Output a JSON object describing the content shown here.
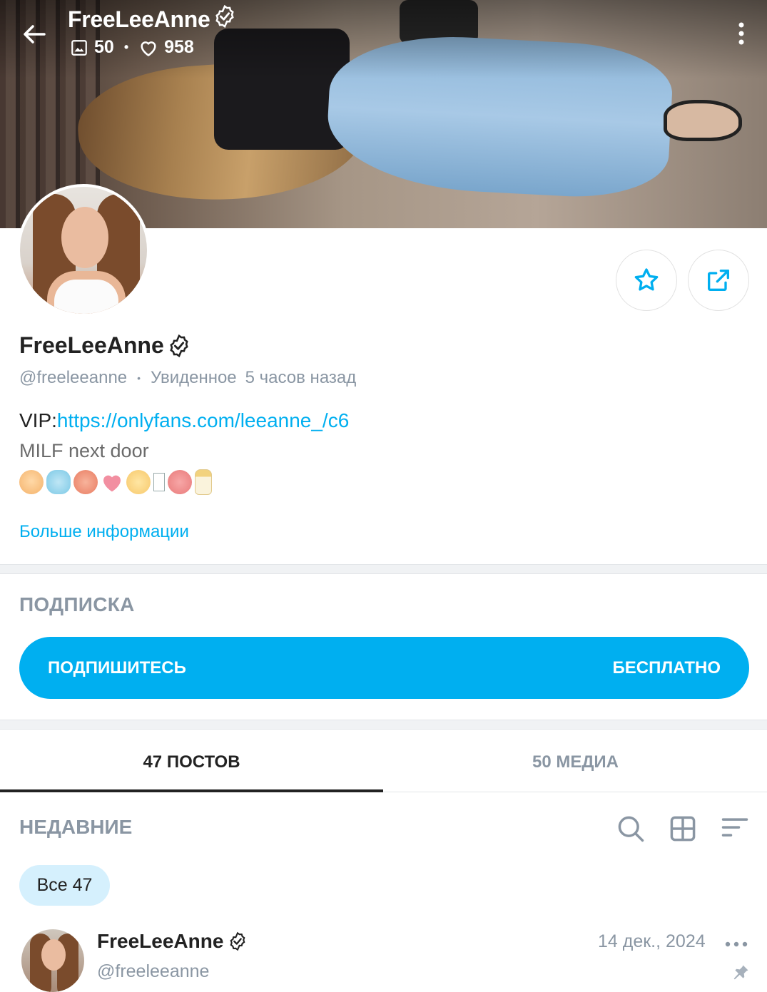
{
  "header": {
    "title": "FreeLeeAnne",
    "media_count": "50",
    "likes_count": "958"
  },
  "profile": {
    "name": "FreeLeeAnne",
    "handle": "@freeleeanne",
    "seen_label": "Увиденное",
    "seen_time": "5 часов назад",
    "bio_prefix": "VIP:",
    "bio_link": "https://onlyfans.com/leeanne_/c6",
    "bio_line": "MILF next door",
    "more_info": "Больше информации"
  },
  "subscription": {
    "title": "ПОДПИСКА",
    "button_label": "ПОДПИШИТЕСЬ",
    "button_price": "БЕСПЛАТНО"
  },
  "tabs": [
    {
      "label": "47 ПОСТОВ",
      "active": true
    },
    {
      "label": "50 МЕДИА",
      "active": false
    }
  ],
  "feed": {
    "section_title": "НЕДАВНИЕ",
    "filter_chip": "Все 47"
  },
  "post": {
    "author": "FreeLeeAnne",
    "handle": "@freeleeanne",
    "date": "14 дек., 2024"
  },
  "colors": {
    "accent": "#00aff0",
    "muted": "#8a96a3",
    "chip_bg": "#d5f0fd"
  },
  "icons": [
    "back-arrow-icon",
    "verified-badge-icon",
    "image-icon",
    "heart-icon",
    "more-vertical-icon",
    "star-icon",
    "share-icon",
    "search-icon",
    "grid-icon",
    "sort-icon",
    "more-horizontal-icon",
    "pin-icon"
  ]
}
